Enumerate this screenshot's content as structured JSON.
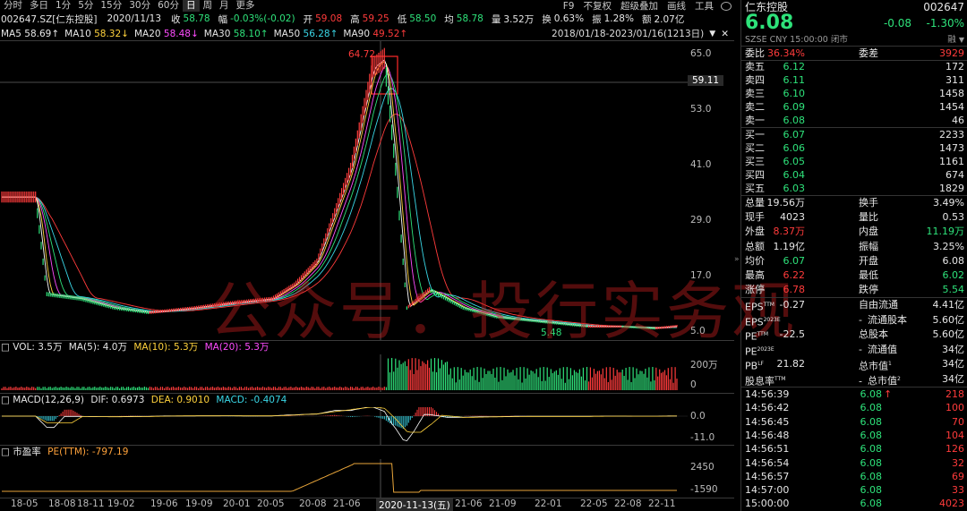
{
  "toolbar": {
    "timeframes": [
      "分时",
      "多日",
      "1分",
      "5分",
      "15分",
      "30分",
      "60分",
      "日",
      "周",
      "月",
      "更多"
    ],
    "right": [
      "F9",
      "不复权",
      "超级叠加",
      "画线",
      "工具"
    ]
  },
  "info": {
    "code": "002647.SZ[仁东控股]",
    "date": "2020/11/13",
    "close_label": "收",
    "close": "58.78",
    "amp_label": "幅",
    "amp": "-0.03%(-0.02)",
    "open_label": "开",
    "open": "59.08",
    "high_label": "高",
    "high": "59.25",
    "low_label": "低",
    "low": "58.50",
    "avg_label": "均",
    "avg": "58.78",
    "vol_label": "量",
    "vol": "3.52万",
    "turn_label": "换",
    "turn": "0.63%",
    "swing_label": "振",
    "swing": "1.28%",
    "amt_label": "额",
    "amt": "2.07亿"
  },
  "ma": {
    "ma5_label": "MA5",
    "ma5": "58.69↑",
    "ma10_label": "MA10",
    "ma10": "58.32↓",
    "ma20_label": "MA20",
    "ma20": "58.48↓",
    "ma30_label": "MA30",
    "ma30": "58.10↑",
    "ma50_label": "MA50",
    "ma50": "56.28↑",
    "ma90_label": "MA90",
    "ma90": "49.52↑",
    "range": "2018/01/18-2023/01/16(1213日)"
  },
  "main_chart": {
    "y_ticks": [
      "65.0",
      "53.0",
      "41.0",
      "29.0",
      "17.0",
      "5.0"
    ],
    "crosshair_price": "59.11",
    "peak_label": "64.72",
    "low_label": "5.48",
    "watermark": "公众号：投行实务观"
  },
  "vol_panel": {
    "label": "VOL: 3.5万",
    "ma5": "MA(5): 4.0万",
    "ma10": "MA(10): 5.3万",
    "ma20": "MA(20): 5.3万",
    "y_ticks": [
      "200万",
      "0"
    ]
  },
  "macd_panel": {
    "label": "MACD(12,26,9)",
    "dif": "DIF: 0.6973",
    "dea": "DEA: 0.9010",
    "macd": "MACD: -0.4074",
    "y_ticks": [
      "0.0",
      "-11.0"
    ]
  },
  "pe_panel": {
    "label": "市盈率",
    "pe": "PE(TTM): -797.19",
    "y_ticks": [
      "2450",
      "-1590"
    ]
  },
  "x_axis": {
    "ticks": [
      "18-05",
      "18-08",
      "18-11",
      "19-02",
      "19-06",
      "19-09",
      "20-01",
      "20-05",
      "20-08",
      "21-06",
      "21-09",
      "22-01",
      "22-05",
      "22-08",
      "22-11"
    ],
    "crosshair_date": "2020-11-13(五)"
  },
  "quote": {
    "name": "仁东控股",
    "code": "002647",
    "price": "6.08",
    "change": "-0.08",
    "change_pct": "-1.30%",
    "market": "SZSE CNY 15:00:00 闭市",
    "margin_tag": "融",
    "weibi_label": "委比",
    "weibi": "36.34%",
    "weicha_label": "委差",
    "weicha": "3929",
    "asks": [
      {
        "label": "卖五",
        "price": "6.12",
        "vol": "172"
      },
      {
        "label": "卖四",
        "price": "6.11",
        "vol": "311"
      },
      {
        "label": "卖三",
        "price": "6.10",
        "vol": "1458"
      },
      {
        "label": "卖二",
        "price": "6.09",
        "vol": "1454"
      },
      {
        "label": "卖一",
        "price": "6.08",
        "vol": "46"
      }
    ],
    "bids": [
      {
        "label": "买一",
        "price": "6.07",
        "vol": "2233"
      },
      {
        "label": "买二",
        "price": "6.06",
        "vol": "1473"
      },
      {
        "label": "买三",
        "price": "6.05",
        "vol": "1161"
      },
      {
        "label": "买四",
        "price": "6.04",
        "vol": "674"
      },
      {
        "label": "买五",
        "price": "6.03",
        "vol": "1829"
      }
    ],
    "stats": [
      {
        "l1": "总量",
        "v1": "19.56万",
        "l2": "换手",
        "v2": "3.49%"
      },
      {
        "l1": "现手",
        "v1": "4023",
        "l2": "量比",
        "v2": "0.53"
      },
      {
        "l1": "外盘",
        "v1": "8.37万",
        "l2": "内盘",
        "v2": "11.19万"
      },
      {
        "l1": "总额",
        "v1": "1.19亿",
        "l2": "振幅",
        "v2": "3.25%"
      },
      {
        "l1": "均价",
        "v1": "6.07",
        "l2": "开盘",
        "v2": "6.08"
      },
      {
        "l1": "最高",
        "v1": "6.22",
        "l2": "最低",
        "v2": "6.02"
      },
      {
        "l1": "涨停",
        "v1": "6.78",
        "l2": "跌停",
        "v2": "5.54"
      }
    ],
    "fin": [
      {
        "l1": "EPS",
        "s1": "TTM",
        "v1": "-0.27",
        "l2": "自由流通",
        "v2": "4.41亿"
      },
      {
        "l1": "EPS",
        "s1": "2023E",
        "v1": "",
        "l2": "流通股本",
        "v2": "5.60亿"
      },
      {
        "l1": "PE",
        "s1": "TTM",
        "v1": "-22.5",
        "l2": "总股本",
        "v2": "5.60亿"
      },
      {
        "l1": "PE",
        "s1": "2023E",
        "v1": "",
        "l2": "流通值",
        "v2": "34亿"
      },
      {
        "l1": "PB",
        "s1": "LF",
        "v1": "21.82",
        "l2": "总市值",
        "s2": "1",
        "v2": "34亿"
      },
      {
        "l1": "股息率",
        "s1": "TTM",
        "v1": "",
        "l2": "总市值",
        "s2": "2",
        "v2": "34亿"
      }
    ],
    "fin_dash": "-",
    "ticks": [
      {
        "time": "14:56:39",
        "price": "6.08",
        "vol": "218",
        "arrow": "↑"
      },
      {
        "time": "14:56:42",
        "price": "6.08",
        "vol": "100",
        "arrow": ""
      },
      {
        "time": "14:56:45",
        "price": "6.08",
        "vol": "70",
        "arrow": ""
      },
      {
        "time": "14:56:48",
        "price": "6.08",
        "vol": "104",
        "arrow": ""
      },
      {
        "time": "14:56:51",
        "price": "6.08",
        "vol": "126",
        "arrow": ""
      },
      {
        "time": "14:56:54",
        "price": "6.08",
        "vol": "32",
        "arrow": ""
      },
      {
        "time": "14:56:57",
        "price": "6.08",
        "vol": "69",
        "arrow": ""
      },
      {
        "time": "14:57:00",
        "price": "6.08",
        "vol": "33",
        "arrow": ""
      },
      {
        "time": "15:00:00",
        "price": "6.08",
        "vol": "4023",
        "arrow": ""
      }
    ]
  },
  "chart_data": {
    "type": "line",
    "title": "002647.SZ 仁东控股 日线",
    "x_range": [
      "2018/01/18",
      "2023/01/16"
    ],
    "series": [
      {
        "name": "close",
        "x": [
          "2018-01",
          "2018-04",
          "2018-05",
          "2018-08",
          "2018-11",
          "2019-02",
          "2019-06",
          "2019-09",
          "2020-01",
          "2020-03",
          "2020-05",
          "2020-08",
          "2020-10",
          "2020-11",
          "2020-12",
          "2021-01",
          "2021-03",
          "2021-06",
          "2021-09",
          "2022-01",
          "2022-05",
          "2022-08",
          "2022-11",
          "2023-01"
        ],
        "values": [
          34,
          34,
          13,
          12,
          10,
          9,
          10,
          11,
          12,
          15,
          20,
          40,
          62,
          64,
          40,
          10,
          14,
          10,
          8,
          7,
          6,
          6,
          5.6,
          6.1
        ]
      }
    ],
    "ylim": [
      5,
      65
    ]
  },
  "colors": {
    "up": "#ff3b3b",
    "down": "#2ee27a",
    "ma5": "#ffffff",
    "ma10": "#ffd23c",
    "ma20": "#ff4cff",
    "ma30": "#2ee27a",
    "ma50": "#3ad7e7",
    "ma90": "#ff3b3b"
  }
}
